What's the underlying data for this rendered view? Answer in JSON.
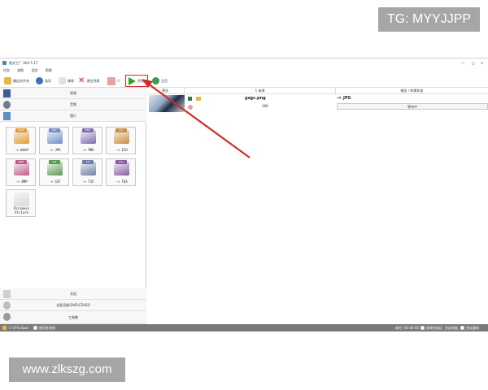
{
  "overlay": {
    "tg": "TG: MYYJJPP",
    "site": "www.zlkszg.com"
  },
  "window": {
    "title": "格式工厂 X64 5.17",
    "controls": [
      "—",
      "□",
      "×"
    ]
  },
  "menu": [
    "任务",
    "皮肤",
    "语言",
    "帮助"
  ],
  "toolbar": {
    "output_folder": "输出文件夹",
    "options": "选项",
    "remove": "移除",
    "clear_list": "清空列表",
    "stop": "停",
    "start": "开始",
    "home": "主页"
  },
  "categories": {
    "video": "视频",
    "audio": "音频",
    "picture": "图片",
    "document": "文档",
    "rom": "光驱设备\\DVD\\CD\\ISO",
    "toolbox": "工具集"
  },
  "formats": [
    {
      "tag": "WebP",
      "label": "-> WebP",
      "color": "#e39a2b"
    },
    {
      "tag": "JPG",
      "label": "-> JPG",
      "color": "#6b8fc9"
    },
    {
      "tag": "PNG",
      "label": "-> PNG",
      "color": "#7d6bb5"
    },
    {
      "tag": "ICO",
      "label": "-> ICO",
      "color": "#d08a3a"
    },
    {
      "tag": "BMP",
      "label": "-> BMP",
      "color": "#c35a8d"
    },
    {
      "tag": "GIF",
      "label": "-> GIF",
      "color": "#5b9b4f"
    },
    {
      "tag": "TIF",
      "label": "-> TIF",
      "color": "#6e7fa8"
    },
    {
      "tag": "TGA",
      "label": "-> TGA",
      "color": "#8a5aa6"
    },
    {
      "tag": "",
      "label": "Picsmess Picture",
      "color": "#d9d9d9"
    }
  ],
  "columns": {
    "preview": "预览",
    "source": "1 来源",
    "output": "输出 / 转换状态"
  },
  "task": {
    "filename": "gsgc.png",
    "size": "28K",
    "target": "-> JPG",
    "status": "等待中"
  },
  "statusbar": {
    "output_path": "C:\\FFOutput",
    "multithread": "使用多线程",
    "elapsed_label": "耗时：",
    "elapsed": "00:00:00",
    "after_done": "转换完成后",
    "shutdown": "关闭电脑",
    "notify": "完成通知"
  },
  "colors": {
    "accent_red": "#d22b2b",
    "start_green": "#2ca02c",
    "statusbar": "#7a7a7a"
  }
}
